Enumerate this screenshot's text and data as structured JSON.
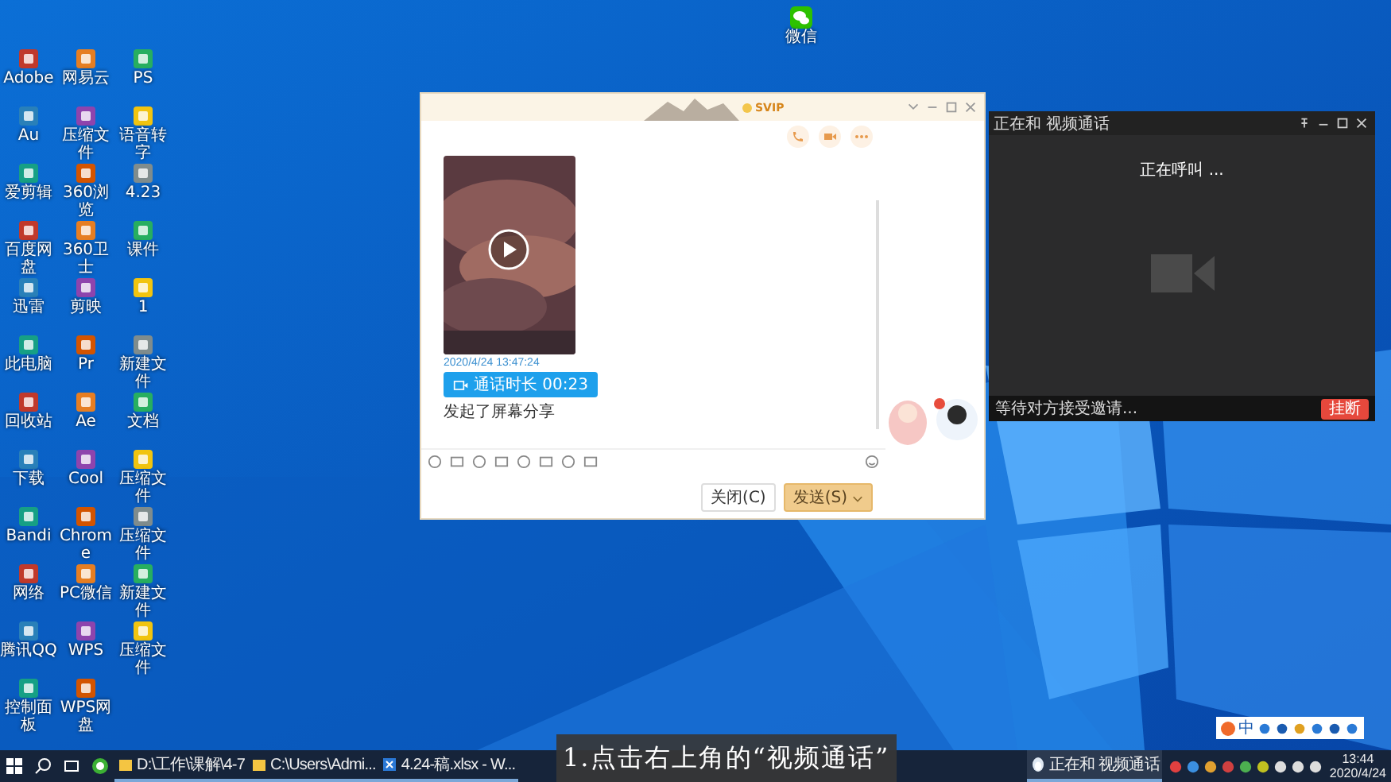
{
  "desktop_icons": [
    {
      "label": "Adobe"
    },
    {
      "label": "网易云"
    },
    {
      "label": "PS"
    },
    {
      "label": "Au"
    },
    {
      "label": "压缩文件"
    },
    {
      "label": "语音转字"
    },
    {
      "label": "爱剪辑"
    },
    {
      "label": "360浏览"
    },
    {
      "label": "4.23"
    },
    {
      "label": "百度网盘"
    },
    {
      "label": "360卫士"
    },
    {
      "label": "课件"
    },
    {
      "label": "迅雷"
    },
    {
      "label": "剪映"
    },
    {
      "label": "1"
    },
    {
      "label": "此电脑"
    },
    {
      "label": "Pr"
    },
    {
      "label": "新建文件"
    },
    {
      "label": "回收站"
    },
    {
      "label": "Ae"
    },
    {
      "label": "文档"
    },
    {
      "label": "下载"
    },
    {
      "label": "Cool"
    },
    {
      "label": "压缩文件"
    },
    {
      "label": "Bandi"
    },
    {
      "label": "Chrome"
    },
    {
      "label": "压缩文件"
    },
    {
      "label": "网络"
    },
    {
      "label": "PC微信"
    },
    {
      "label": "新建文件"
    },
    {
      "label": "腾讯QQ"
    },
    {
      "label": "WPS"
    },
    {
      "label": "压缩文件"
    },
    {
      "label": "控制面板"
    },
    {
      "label": "WPS网盘"
    }
  ],
  "top_icon": {
    "label": "微信"
  },
  "chat_window": {
    "vip_badge": "SVIP",
    "timestamp": "2020/4/24 13:47:24",
    "call_bubble": "通话时长 00:23",
    "share_note": "发起了屏幕分享",
    "buttons": [
      {
        "label": "关闭(C)",
        "kind": "plain"
      },
      {
        "label": "发送(S)",
        "kind": "primary"
      }
    ]
  },
  "video_call": {
    "title": "正在和 视频通话",
    "status": "正在呼叫 ...",
    "waiting": "等待对方接受邀请...",
    "hangup": "挂断"
  },
  "ime_bar": {
    "mode": "中"
  },
  "taskbar": {
    "items": [
      {
        "label": "D:\\工作\\课解\\4-7",
        "kind": "folder"
      },
      {
        "label": "C:\\Users\\Admi...",
        "kind": "folder"
      },
      {
        "label": "4.24-稿.xlsx - W...",
        "kind": "sheet"
      },
      {
        "label": "正在和 视频通话",
        "kind": "call"
      }
    ],
    "time": "13:44",
    "date": "2020/4/24"
  },
  "caption": "1.点击右上角的“视频通话”"
}
